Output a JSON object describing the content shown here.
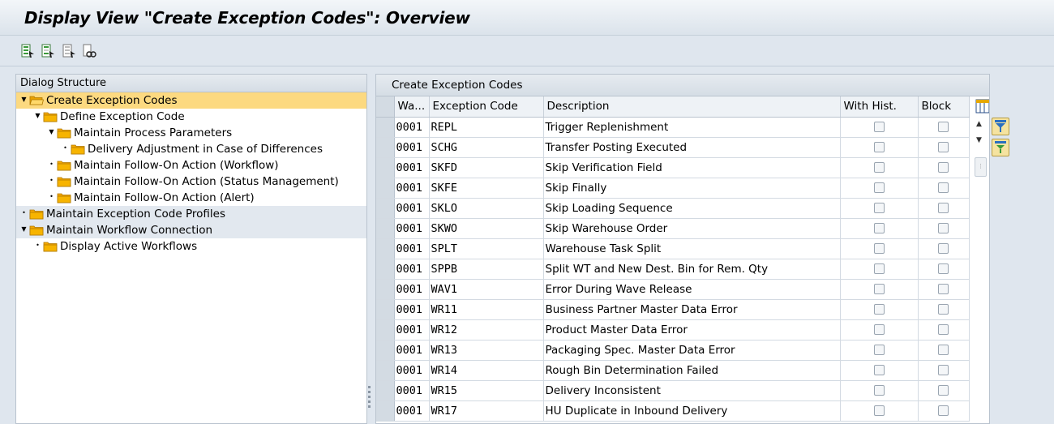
{
  "window": {
    "title": "Display View \"Create Exception Codes\": Overview"
  },
  "toolbar": {
    "buttons": [
      "select-all-icon",
      "select-block-icon",
      "deselect-all-icon",
      "find-icon"
    ]
  },
  "dialog_structure": {
    "header": "Dialog Structure",
    "items": [
      {
        "label": "Create Exception Codes",
        "expanded": true,
        "selected": true
      },
      {
        "label": "Define Exception Code",
        "expanded": true
      },
      {
        "label": "Maintain Process Parameters",
        "expanded": true
      },
      {
        "label": "Delivery Adjustment in Case of Differences"
      },
      {
        "label": "Maintain Follow-On Action (Workflow)"
      },
      {
        "label": "Maintain Follow-On Action (Status Management)"
      },
      {
        "label": "Maintain Follow-On Action (Alert)"
      },
      {
        "label": "Maintain Exception Code Profiles"
      },
      {
        "label": "Maintain Workflow Connection",
        "expanded": true
      },
      {
        "label": "Display Active Workflows"
      }
    ]
  },
  "table": {
    "title": "Create Exception Codes",
    "columns": [
      "Wa...",
      "Exception Code",
      "Description",
      "With Hist.",
      "Block"
    ],
    "rows": [
      {
        "wa": "0001",
        "code": "REPL",
        "desc": "Trigger Replenishment"
      },
      {
        "wa": "0001",
        "code": "SCHG",
        "desc": "Transfer Posting Executed"
      },
      {
        "wa": "0001",
        "code": "SKFD",
        "desc": "Skip Verification Field"
      },
      {
        "wa": "0001",
        "code": "SKFE",
        "desc": "Skip Finally"
      },
      {
        "wa": "0001",
        "code": "SKLO",
        "desc": "Skip Loading Sequence"
      },
      {
        "wa": "0001",
        "code": "SKWO",
        "desc": "Skip Warehouse Order"
      },
      {
        "wa": "0001",
        "code": "SPLT",
        "desc": "Warehouse Task Split"
      },
      {
        "wa": "0001",
        "code": "SPPB",
        "desc": "Split WT and New Dest. Bin for Rem. Qty"
      },
      {
        "wa": "0001",
        "code": "WAV1",
        "desc": "Error During Wave Release"
      },
      {
        "wa": "0001",
        "code": "WR11",
        "desc": "Business Partner Master Data Error"
      },
      {
        "wa": "0001",
        "code": "WR12",
        "desc": "Product Master Data Error"
      },
      {
        "wa": "0001",
        "code": "WR13",
        "desc": "Packaging Spec. Master Data Error"
      },
      {
        "wa": "0001",
        "code": "WR14",
        "desc": "Rough Bin Determination Failed"
      },
      {
        "wa": "0001",
        "code": "WR15",
        "desc": "Delivery Inconsistent"
      },
      {
        "wa": "0001",
        "code": "WR17",
        "desc": "HU Duplicate in Inbound Delivery"
      }
    ]
  },
  "side_buttons": [
    "filter-icon",
    "sort-icon"
  ],
  "colors": {
    "selected_row": "#fcd980",
    "folder": "#f5a800",
    "background": "#dfe6ee"
  }
}
